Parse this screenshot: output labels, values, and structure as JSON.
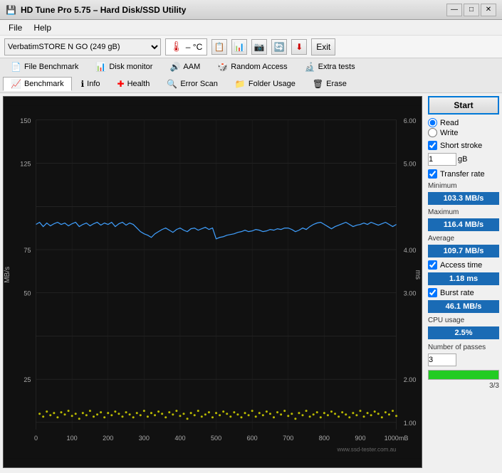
{
  "titlebar": {
    "title": "HD Tune Pro 5.75 – Hard Disk/SSD Utility",
    "icon": "💾",
    "controls": {
      "minimize": "—",
      "maximize": "□",
      "close": "✕"
    }
  },
  "menubar": {
    "items": [
      "File",
      "Help"
    ]
  },
  "toolbar": {
    "drive_label": "VerbatimSTORE N GO (249 gB)",
    "temp_icon": "🌡",
    "temp_value": "– °C",
    "exit_label": "Exit"
  },
  "tabs": {
    "row1": [
      {
        "label": "File Benchmark",
        "icon": "📄"
      },
      {
        "label": "Disk monitor",
        "icon": "📊"
      },
      {
        "label": "AAM",
        "icon": "🔊"
      },
      {
        "label": "Random Access",
        "icon": "🎲"
      },
      {
        "label": "Extra tests",
        "icon": "🔬"
      }
    ],
    "row2": [
      {
        "label": "Benchmark",
        "icon": "📈",
        "active": true
      },
      {
        "label": "Info",
        "icon": "ℹ"
      },
      {
        "label": "Health",
        "icon": "➕"
      },
      {
        "label": "Error Scan",
        "icon": "🔍"
      },
      {
        "label": "Folder Usage",
        "icon": "📁"
      },
      {
        "label": "Erase",
        "icon": "🗑"
      }
    ]
  },
  "chart": {
    "y_axis_left_label": "MB/s",
    "y_axis_right_label": "ms",
    "y_left_ticks": [
      "150",
      "125",
      "75",
      "50",
      "25"
    ],
    "y_right_ticks": [
      "6.00",
      "5.00",
      "4.00",
      "3.00",
      "2.00",
      "1.00"
    ],
    "x_ticks": [
      "0",
      "100",
      "200",
      "300",
      "400",
      "500",
      "600",
      "700",
      "800",
      "900",
      "1000mB"
    ],
    "watermark": "www.ssd-tester.com.au"
  },
  "controls": {
    "start_label": "Start",
    "read_label": "Read",
    "write_label": "Write",
    "short_stroke_label": "Short stroke",
    "short_stroke_value": "1",
    "short_stroke_unit": "gB",
    "transfer_rate_label": "Transfer rate",
    "minimum_label": "Minimum",
    "minimum_value": "103.3 MB/s",
    "maximum_label": "Maximum",
    "maximum_value": "116.4 MB/s",
    "average_label": "Average",
    "average_value": "109.7 MB/s",
    "access_time_label": "Access time",
    "access_time_value": "1.18 ms",
    "burst_rate_label": "Burst rate",
    "burst_rate_value": "46.1 MB/s",
    "cpu_usage_label": "CPU usage",
    "cpu_usage_value": "2.5%",
    "number_of_passes_label": "Number of passes",
    "passes_value": "3",
    "passes_progress": "3/3",
    "passes_progress_pct": 100
  }
}
